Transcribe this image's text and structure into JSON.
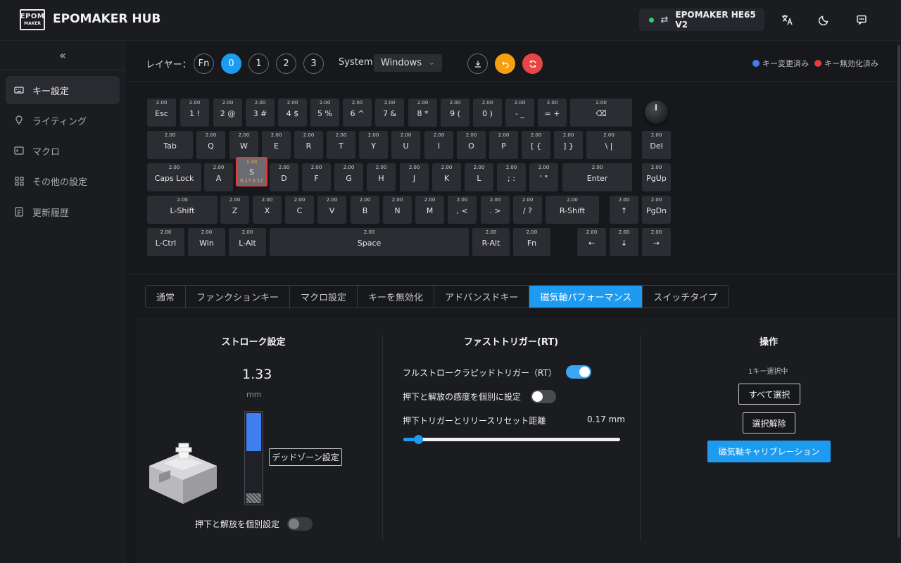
{
  "header": {
    "logo_line1": "EPOM",
    "logo_line2": "MAKER",
    "app_title": "EPOMAKER HUB",
    "device_name": "EPOMAKER HE65 V2"
  },
  "sidebar": {
    "items": [
      {
        "label": "キー設定",
        "icon": "keyboard-icon",
        "active": true
      },
      {
        "label": "ライティング",
        "icon": "bulb-icon",
        "active": false
      },
      {
        "label": "マクロ",
        "icon": "terminal-icon",
        "active": false
      },
      {
        "label": "その他の設定",
        "icon": "grid-icon",
        "active": false
      },
      {
        "label": "更新履歴",
        "icon": "document-icon",
        "active": false
      }
    ]
  },
  "toolbar": {
    "layer_label": "レイヤー：",
    "layers": [
      "Fn",
      "0",
      "1",
      "2",
      "3"
    ],
    "active_layer": "0",
    "system_label": "System",
    "system_value": "Windows",
    "legend_changed": "キー変更済み",
    "legend_disabled": "キー無効化済み"
  },
  "colors": {
    "accent": "#1d9bf0",
    "changed": "#3d7ef0",
    "disabled": "#e23b3b",
    "undo": "#f5a00f",
    "reset": "#e84545"
  },
  "keyboard": {
    "rows": [
      [
        {
          "label": "Esc",
          "value": "2.00"
        },
        {
          "label": "1 !",
          "value": "2.00"
        },
        {
          "label": "2 @",
          "value": "2.00"
        },
        {
          "label": "3 #",
          "value": "2.00"
        },
        {
          "label": "4 $",
          "value": "2.00"
        },
        {
          "label": "5 %",
          "value": "2.00"
        },
        {
          "label": "6 ^",
          "value": "2.00"
        },
        {
          "label": "7 &",
          "value": "2.00"
        },
        {
          "label": "8 *",
          "value": "2.00"
        },
        {
          "label": "9 (",
          "value": "2.00"
        },
        {
          "label": "0 )",
          "value": "2.00"
        },
        {
          "label": "- _",
          "value": "2.00"
        },
        {
          "label": "= +",
          "value": "2.00"
        },
        {
          "label": "⌫",
          "value": "2.00"
        }
      ],
      [
        {
          "label": "Tab",
          "value": "2.00"
        },
        {
          "label": "Q",
          "value": "2.00"
        },
        {
          "label": "W",
          "value": "2.00"
        },
        {
          "label": "E",
          "value": "2.00"
        },
        {
          "label": "R",
          "value": "2.00"
        },
        {
          "label": "T",
          "value": "2.00"
        },
        {
          "label": "Y",
          "value": "2.00"
        },
        {
          "label": "U",
          "value": "2.00"
        },
        {
          "label": "I",
          "value": "2.00"
        },
        {
          "label": "O",
          "value": "2.00"
        },
        {
          "label": "P",
          "value": "2.00"
        },
        {
          "label": "[ {",
          "value": "2.00"
        },
        {
          "label": "] }",
          "value": "2.00"
        },
        {
          "label": "\\ |",
          "value": "2.00"
        },
        {
          "label": "Del",
          "value": "2.00"
        }
      ],
      [
        {
          "label": "Caps Lock",
          "value": "2.00"
        },
        {
          "label": "A",
          "value": "2.00"
        },
        {
          "label": "S",
          "value": "1.33",
          "selected": true,
          "press": "0.17",
          "release": "0.17"
        },
        {
          "label": "D",
          "value": "2.00"
        },
        {
          "label": "F",
          "value": "2.00"
        },
        {
          "label": "G",
          "value": "2.00"
        },
        {
          "label": "H",
          "value": "2.00"
        },
        {
          "label": "J",
          "value": "2.00"
        },
        {
          "label": "K",
          "value": "2.00"
        },
        {
          "label": "L",
          "value": "2.00"
        },
        {
          "label": "; :",
          "value": "2.00"
        },
        {
          "label": "' \"",
          "value": "2.00"
        },
        {
          "label": "Enter",
          "value": "2.00"
        },
        {
          "label": "PgUp",
          "value": "2.00"
        }
      ],
      [
        {
          "label": "L-Shift",
          "value": "2.00"
        },
        {
          "label": "Z",
          "value": "2.00"
        },
        {
          "label": "X",
          "value": "2.00"
        },
        {
          "label": "C",
          "value": "2.00"
        },
        {
          "label": "V",
          "value": "2.00"
        },
        {
          "label": "B",
          "value": "2.00"
        },
        {
          "label": "N",
          "value": "2.00"
        },
        {
          "label": "M",
          "value": "2.00"
        },
        {
          "label": ", <",
          "value": "2.00"
        },
        {
          "label": ". >",
          "value": "2.00"
        },
        {
          "label": "/ ?",
          "value": "2.00"
        },
        {
          "label": "R-Shift",
          "value": "2.00"
        },
        {
          "label": "↑",
          "value": "2.00"
        },
        {
          "label": "PgDn",
          "value": "2.00"
        }
      ],
      [
        {
          "label": "L-Ctrl",
          "value": "2.00"
        },
        {
          "label": "Win",
          "value": "2.00"
        },
        {
          "label": "L-Alt",
          "value": "2.00"
        },
        {
          "label": "Space",
          "value": "2.00"
        },
        {
          "label": "R-Alt",
          "value": "2.00"
        },
        {
          "label": "Fn",
          "value": "2.00"
        },
        {
          "label": "←",
          "value": "2.00"
        },
        {
          "label": "↓",
          "value": "2.00"
        },
        {
          "label": "→",
          "value": "2.00"
        }
      ]
    ]
  },
  "tabs": {
    "items": [
      "通常",
      "ファンクションキー",
      "マクロ設定",
      "キーを無効化",
      "アドバンスドキー",
      "磁気軸パフォーマンス",
      "スイッチタイプ"
    ],
    "active": "磁気軸パフォーマンス"
  },
  "stroke": {
    "title": "ストローク設定",
    "value": "1.33",
    "unit": "mm",
    "deadzone_button": "デッドゾーン設定",
    "separate_label": "押下と解放を個別設定",
    "separate_on": false
  },
  "rt": {
    "title": "ファストトリガー(RT)",
    "full_stroke_label": "フルストロークラピッドトリガー（RT）",
    "full_stroke_on": true,
    "separate_sensitivity_label": "押下と解放の感度を個別に設定",
    "separate_sensitivity_on": false,
    "distance_label": "押下トリガーとリリースリセット距離",
    "distance_value": "0.17 mm",
    "distance_fraction": 0.05
  },
  "operations": {
    "title": "操作",
    "selection_note": "1キー選択中",
    "select_all": "すべて選択",
    "deselect": "選択解除",
    "calibration": "磁気軸キャリブレーション"
  }
}
